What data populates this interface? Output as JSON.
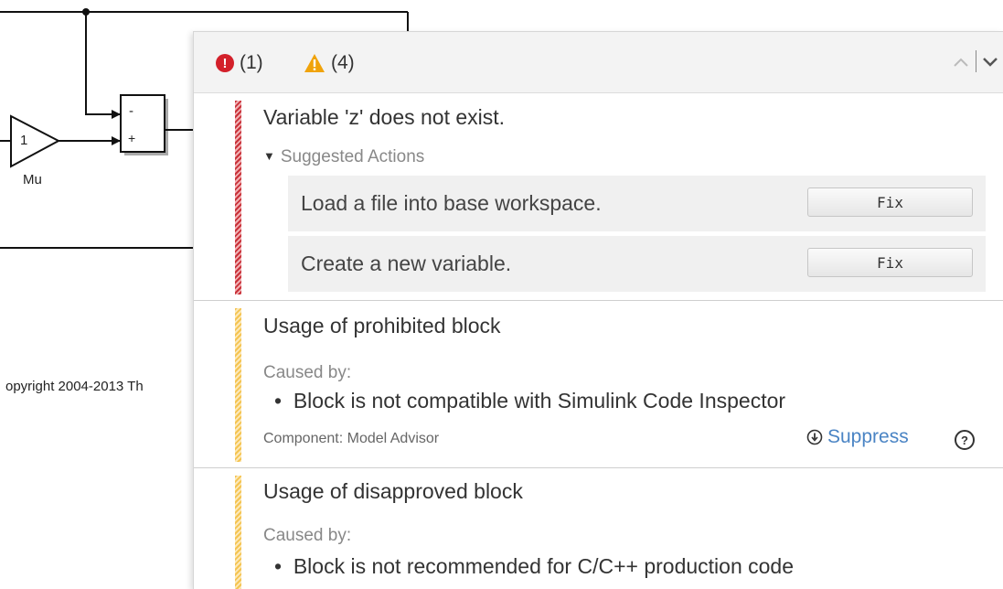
{
  "canvas": {
    "gain_value": "1",
    "gain_label": "Mu",
    "sum_signs": [
      "-",
      "+"
    ],
    "copyright": "opyright 2004-2013 Th"
  },
  "header": {
    "errors": {
      "icon": "error-icon",
      "text": "(1)",
      "color": "#d3202a"
    },
    "warnings": {
      "icon": "warning-icon",
      "text": "(4)",
      "color": "#f0a30a"
    },
    "nav_up": "^",
    "nav_down": "⌄"
  },
  "messages": [
    {
      "severity": "error",
      "title": "Variable 'z' does not exist.",
      "suggested_actions_label": "Suggested Actions",
      "actions": [
        {
          "text": "Load a file into base workspace.",
          "button": "Fix"
        },
        {
          "text": "Create a new variable.",
          "button": "Fix"
        }
      ]
    },
    {
      "severity": "warning",
      "title": "Usage of prohibited block",
      "caused_by_label": "Caused by:",
      "cause": "Block is not compatible with Simulink Code Inspector",
      "component": "Component: Model Advisor",
      "suppress_label": "Suppress",
      "help": "?"
    },
    {
      "severity": "warning",
      "title": "Usage of disapproved block",
      "caused_by_label": "Caused by:",
      "cause": "Block is not recommended for C/C++ production code"
    }
  ]
}
